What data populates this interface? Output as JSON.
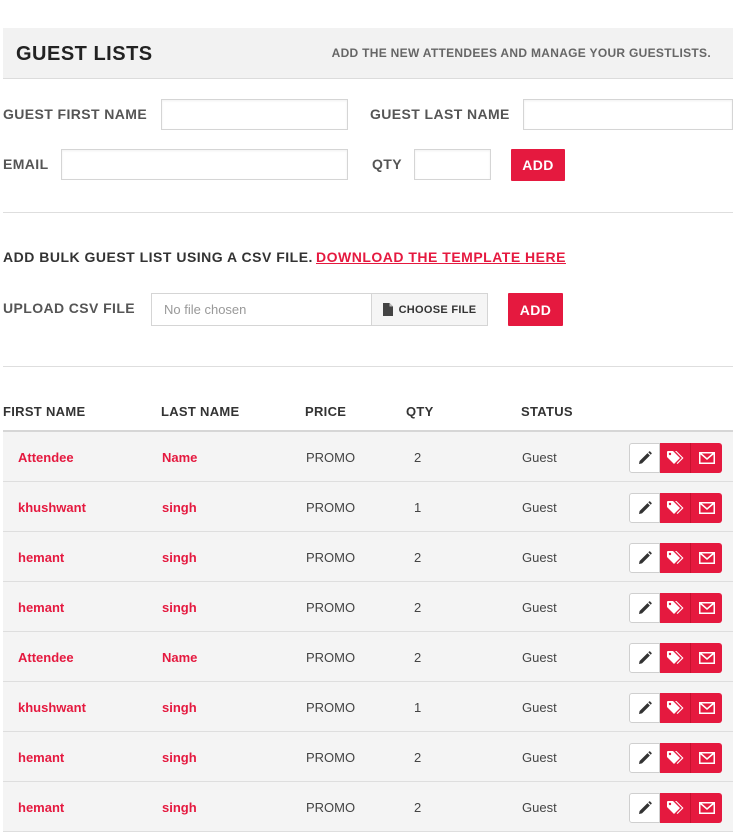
{
  "header": {
    "title": "GUEST LISTS",
    "subtitle": "ADD THE NEW ATTENDEES AND MANAGE YOUR GUESTLISTS."
  },
  "form": {
    "first_name_label": "GUEST FIRST NAME",
    "last_name_label": "GUEST LAST NAME",
    "email_label": "EMAIL",
    "qty_label": "QTY",
    "first_name_value": "",
    "last_name_value": "",
    "email_value": "",
    "qty_value": "",
    "add_label": "ADD"
  },
  "bulk": {
    "text": "ADD BULK GUEST LIST USING A CSV FILE.",
    "link": "DOWNLOAD THE TEMPLATE HERE",
    "upload_label": "UPLOAD CSV FILE",
    "file_placeholder": "No file chosen",
    "choose_label": "CHOOSE FILE",
    "add_label": "ADD"
  },
  "table": {
    "columns": [
      "FIRST NAME",
      "LAST NAME",
      "PRICE",
      "QTY",
      "STATUS"
    ],
    "rows": [
      {
        "first": "Attendee",
        "last": "Name",
        "price": "PROMO",
        "qty": "2",
        "status": "Guest"
      },
      {
        "first": "khushwant",
        "last": "singh",
        "price": "PROMO",
        "qty": "1",
        "status": "Guest"
      },
      {
        "first": "hemant",
        "last": "singh",
        "price": "PROMO",
        "qty": "2",
        "status": "Guest"
      },
      {
        "first": "hemant",
        "last": "singh",
        "price": "PROMO",
        "qty": "2",
        "status": "Guest"
      },
      {
        "first": "Attendee",
        "last": "Name",
        "price": "PROMO",
        "qty": "2",
        "status": "Guest"
      },
      {
        "first": "khushwant",
        "last": "singh",
        "price": "PROMO",
        "qty": "1",
        "status": "Guest"
      },
      {
        "first": "hemant",
        "last": "singh",
        "price": "PROMO",
        "qty": "2",
        "status": "Guest"
      },
      {
        "first": "hemant",
        "last": "singh",
        "price": "PROMO",
        "qty": "2",
        "status": "Guest"
      }
    ],
    "row_actions": [
      "pencil-icon",
      "tag-icon",
      "envelope-icon"
    ]
  },
  "colors": {
    "accent": "#e5193f",
    "header_bg": "#f2f2f2",
    "row_bg": "#f4f4f4"
  }
}
